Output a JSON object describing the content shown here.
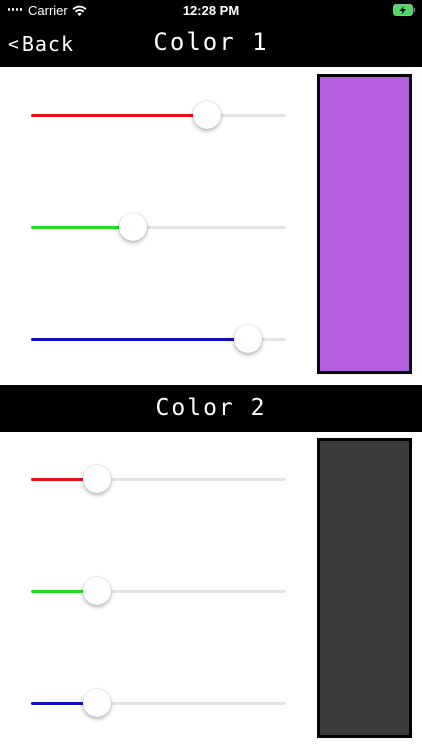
{
  "status_bar": {
    "carrier": "Carrier",
    "time": "12:28 PM"
  },
  "nav": {
    "back_label": "Back",
    "back_chevron": "<",
    "title": "Color 1"
  },
  "color1": {
    "swatch_color": "#b35ee0",
    "sliders": [
      {
        "channel": "red",
        "color": "#e8101a",
        "value": 0.69
      },
      {
        "channel": "green",
        "color": "#22dd22",
        "value": 0.4
      },
      {
        "channel": "blue",
        "color": "#1010c0",
        "value": 0.85
      }
    ]
  },
  "color2": {
    "header": "Color 2",
    "swatch_color": "#3b3b3b",
    "sliders": [
      {
        "channel": "red",
        "color": "#e8101a",
        "value": 0.26
      },
      {
        "channel": "green",
        "color": "#22dd22",
        "value": 0.26
      },
      {
        "channel": "blue",
        "color": "#1010c0",
        "value": 0.26
      }
    ]
  }
}
